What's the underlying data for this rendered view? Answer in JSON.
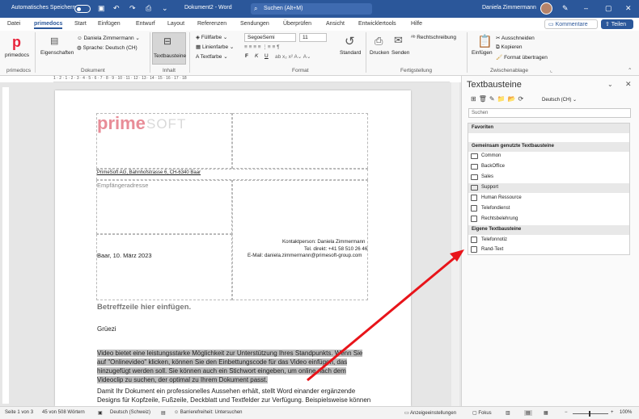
{
  "titlebar": {
    "autosave": "Automatisches Speichern",
    "doc_title": "Dokument2 - Word",
    "search": "Suchen (Alt+M)",
    "user": "Daniela Zimmermann"
  },
  "tabs": [
    "Datei",
    "primedocs",
    "Start",
    "Einfügen",
    "Entwurf",
    "Layout",
    "Referenzen",
    "Sendungen",
    "Überprüfen",
    "Ansicht",
    "Entwicklertools",
    "Hilfe"
  ],
  "tab_actions": {
    "comments": "Kommentare",
    "share": "Teilen"
  },
  "ribbon": {
    "primedocs_btn": "primedocs",
    "eigenschaften": "Eigenschaften",
    "user_combo": "Daniela Zimmermann",
    "language": "Sprache: Deutsch (CH)",
    "textbausteine": "Textbausteine",
    "fuellfarbe": "Füllfarbe",
    "linienfarbe": "Linienfarbe",
    "textfarbe": "Textfarbe",
    "font_name": "SegoeSemi",
    "font_size": "11",
    "standard": "Standard",
    "drucken": "Drucken",
    "senden": "Senden",
    "rechtschreibung": "Rechtschreibung",
    "einfuegen": "Einfügen",
    "ausschneiden": "Ausschneiden",
    "kopieren": "Kopieren",
    "format": "Format übertragen",
    "groups": {
      "primedocs": "primedocs",
      "dokument": "Dokument",
      "inhalt": "Inhalt",
      "format": "Format",
      "fertigstellung": "Fertigstellung",
      "zwischenablage": "Zwischenablage"
    },
    "bold": "F",
    "italic": "K",
    "underline": "U"
  },
  "ruler": "1 · 2 · 1 · 2 · 3 · 4 · 5 · 6 · 7 · 8 · 9 · 10 · 11 · 12 · 13 · 14 · 15 · 16 · 17 · 18",
  "document": {
    "logo_prime": "prime",
    "logo_soft": "SOFT",
    "sender": "PrimeSoft AG, Bahnhofstrasse 6, CH-6340 Baar",
    "recipient": "Empfängeradresse",
    "date": "Baar, 10. März 2023",
    "contact": [
      "Kontaktperson: Daniela Zimmermann",
      "Tel. direkt: +41 58 510 26 46",
      "E-Mail: daniela.zimmermann@primesoft-group.com"
    ],
    "subject": "Betreffzeile hier einfügen.",
    "greeting": "Grüezi",
    "para1": [
      "Video bietet eine leistungsstarke Möglichkeit zur Unterstützung Ihres Standpunkts. Wenn Sie",
      "auf \"Onlinevideo\" klicken, können Sie den Einbettungscode für das Video einfügen, das",
      "hinzugefügt werden soll. Sie können auch ein Stichwort eingeben, um online nach dem",
      "Videoclip zu suchen, der optimal zu Ihrem Dokument passt."
    ],
    "para2": [
      "Damit Ihr Dokument ein professionelles Aussehen erhält, stellt Word einander ergänzende",
      "Designs für Kopfzeile, Fußzeile, Deckblatt und Textfelder zur Verfügung. Beispielsweise können"
    ]
  },
  "pane": {
    "title": "Textbausteine",
    "language": "Deutsch (CH)",
    "search_placeholder": "Suchen",
    "rows": [
      {
        "label": "Favoriten",
        "kind": "hdr"
      },
      {
        "label": "",
        "kind": "blank"
      },
      {
        "label": "Gemeinsam genutzte Textbausteine",
        "kind": "hdr"
      },
      {
        "label": "Common",
        "kind": "folder"
      },
      {
        "label": "BackOffice",
        "kind": "folder"
      },
      {
        "label": "Sales",
        "kind": "folder"
      },
      {
        "label": "Support",
        "kind": "folder-sel"
      },
      {
        "label": "Human Ressource",
        "kind": "doc"
      },
      {
        "label": "Telefondienst",
        "kind": "doc"
      },
      {
        "label": "Rechtsbelehrung",
        "kind": "doc"
      },
      {
        "label": "Eigene Textbausteine",
        "kind": "hdr"
      },
      {
        "label": "Telefonnotiz",
        "kind": "doc"
      },
      {
        "label": "Rand-Text",
        "kind": "doc"
      }
    ]
  },
  "status": {
    "page": "Seite 1 von 3",
    "words": "45 von 508 Wörtern",
    "lang": "Deutsch (Schweiz)",
    "access": "Barrierefreiheit: Untersuchen",
    "display": "Anzeigeeinstellungen",
    "focus": "Fokus",
    "zoom": "100%"
  },
  "colors": {
    "brand": "#2b579a",
    "logo": "#e88c97",
    "arrow": "#e8141a"
  }
}
